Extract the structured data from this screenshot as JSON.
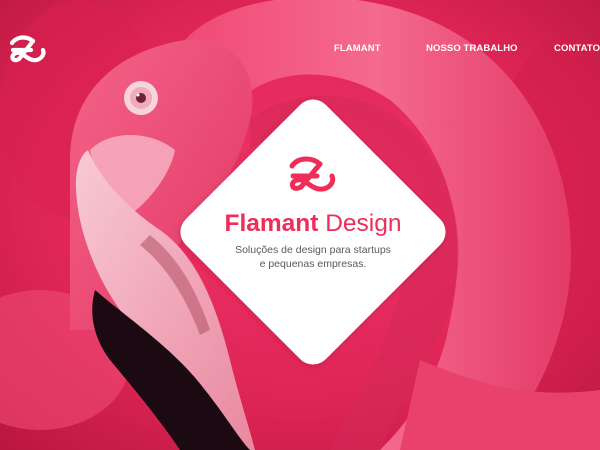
{
  "nav": {
    "items": [
      {
        "label": "FLAMANT"
      },
      {
        "label": "NOSSO TRABALHO"
      },
      {
        "label": "CONTATO"
      }
    ]
  },
  "brand": {
    "name_bold": "Flamant",
    "name_light": "Design",
    "tagline_line1": "Soluções de design para startups",
    "tagline_line2": "e pequenas empresas."
  },
  "icons": {
    "logo": "flamant-monogram-icon",
    "card_logo": "flamant-monogram-icon"
  },
  "colors": {
    "accent": "#ee2d58",
    "background": "#e8275a",
    "card": "#ffffff",
    "nav_text": "#ffffff",
    "tagline_text": "#5a5a5a"
  }
}
